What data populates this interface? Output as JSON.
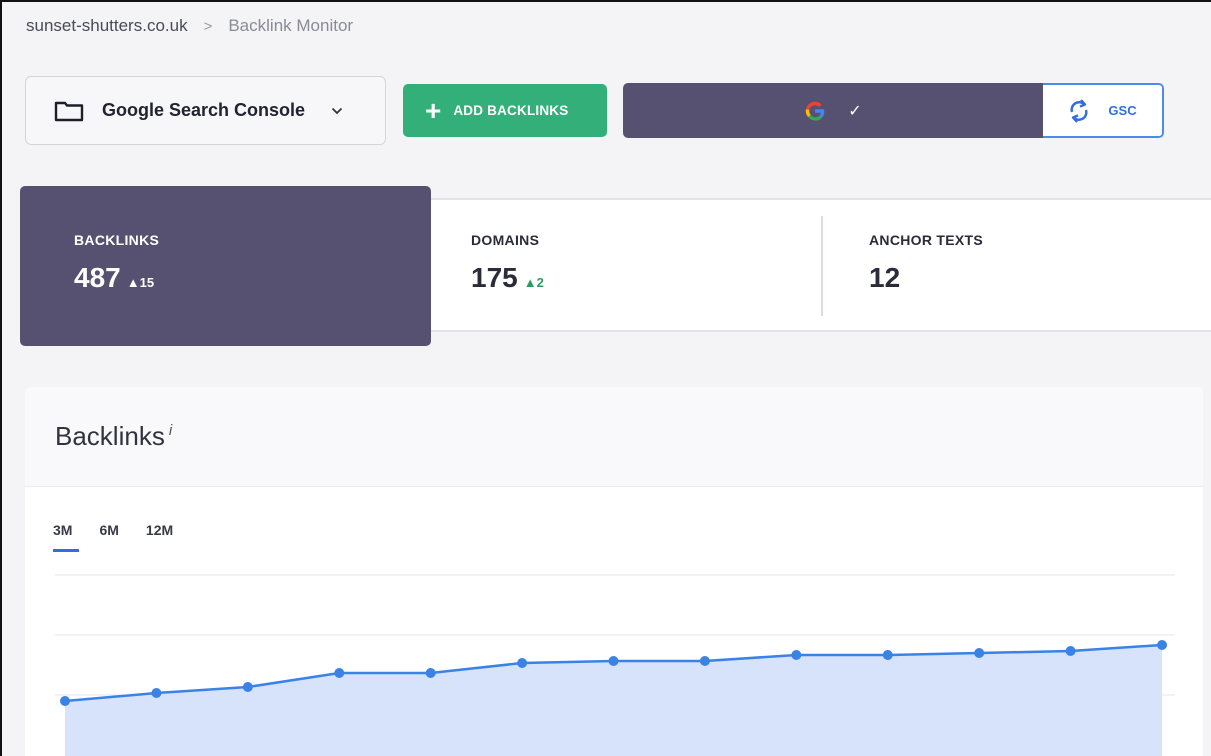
{
  "breadcrumb": {
    "site": "sunset-shutters.co.uk",
    "separator": ">",
    "page": "Backlink Monitor"
  },
  "toolbar": {
    "source_select": {
      "label": "Google Search Console",
      "icon": "folder-icon"
    },
    "add_button": {
      "label": "ADD BACKLINKS",
      "icon": "plus-icon"
    },
    "gsc": {
      "connected_icon": "google-icon",
      "status_icon": "check-icon",
      "sync_label": "GSC",
      "sync_icon": "sync-icon"
    }
  },
  "stats": [
    {
      "title": "BACKLINKS",
      "value": "487",
      "delta": "15",
      "active": true
    },
    {
      "title": "DOMAINS",
      "value": "175",
      "delta": "2",
      "active": false
    },
    {
      "title": "ANCHOR TEXTS",
      "value": "12",
      "active": false
    }
  ],
  "card": {
    "title": "Backlinks",
    "info_mark": "i",
    "tabs": [
      {
        "label": "3M",
        "active": true
      },
      {
        "label": "6M",
        "active": false
      },
      {
        "label": "12M",
        "active": false
      }
    ]
  },
  "chart_data": {
    "type": "area",
    "values": [
      448,
      452,
      455,
      462,
      462,
      467,
      468,
      468,
      471,
      471,
      472,
      473,
      476
    ],
    "ylim": [
      360,
      510
    ],
    "grid": true,
    "color": "#3b82e6",
    "fill": "#d6e3fb"
  },
  "colors": {
    "accent": "#575171",
    "green": "#33b07a",
    "blue": "#2f6fe0"
  }
}
